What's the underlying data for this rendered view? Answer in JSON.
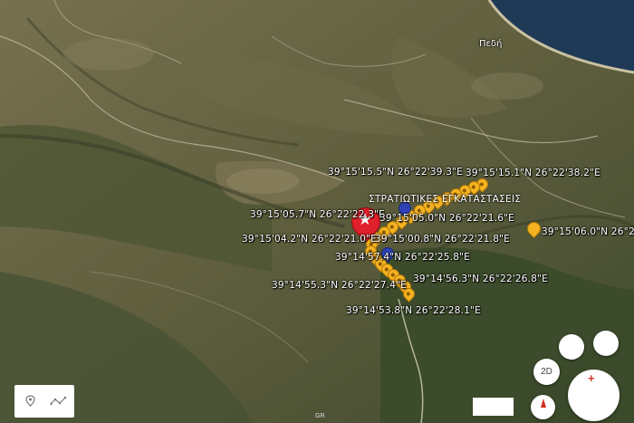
{
  "place_label": "Πεδή",
  "installation_label": "ΣΤΡΑΤΙΩΤΙΚΕΣ ΕΓΚΑΤΑΣΤΑΣΕΙΣ",
  "coordinates": [
    "39°15'15.5\"N 26°22'39.3\"E",
    "39°15'15.1\"N 26°22'38.2\"E",
    "39°15'05.7\"N 26°22'22.3\"E",
    "39°15'05.0\"N 26°22'21.6\"E",
    "39°15'04.2\"N 26°22'21.0\"E",
    "39°15'00.8\"N 26°22'21.8\"E",
    "39°15'06.0\"N 26°22'",
    "39°14'57.4\"N 26°22'25.8\"E",
    "39°14'55.3\"N 26°22'27.4\"E",
    "39°14'56.3\"N 26°22'26.8\"E",
    "39°14'53.8\"N 26°22'28.1\"E"
  ],
  "controls": {
    "view_toggle": "2D"
  },
  "colors": {
    "pin": "#f5b323",
    "accent_pin": "#2f43b6",
    "main_marker": "#e0202a",
    "sea": "#1f3a56"
  },
  "icons": [
    "location-icon",
    "measure-icon",
    "star-icon",
    "compass-icon",
    "zoom-in-icon"
  ],
  "map_source_mark": "GR"
}
